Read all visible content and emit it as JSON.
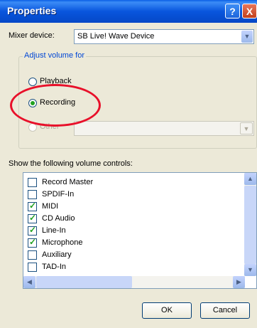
{
  "window": {
    "title": "Properties",
    "help_label": "?",
    "close_label": "X"
  },
  "mixer": {
    "label": "Mixer device:",
    "selected": "SB Live! Wave Device"
  },
  "adjust": {
    "title": "Adjust volume for",
    "options": [
      "Playback",
      "Recording",
      "Other"
    ],
    "selected": "Recording"
  },
  "controls": {
    "label": "Show the following volume controls:",
    "items": [
      {
        "label": "Record Master",
        "checked": false
      },
      {
        "label": "SPDIF-In",
        "checked": false
      },
      {
        "label": "MIDI",
        "checked": true
      },
      {
        "label": "CD Audio",
        "checked": true
      },
      {
        "label": "Line-In",
        "checked": true
      },
      {
        "label": "Microphone",
        "checked": true
      },
      {
        "label": "Auxiliary",
        "checked": false
      },
      {
        "label": "TAD-In",
        "checked": false
      }
    ]
  },
  "buttons": {
    "ok": "OK",
    "cancel": "Cancel"
  },
  "colors": {
    "annotation": "#e8102a",
    "titlebar": "#0855dd"
  }
}
